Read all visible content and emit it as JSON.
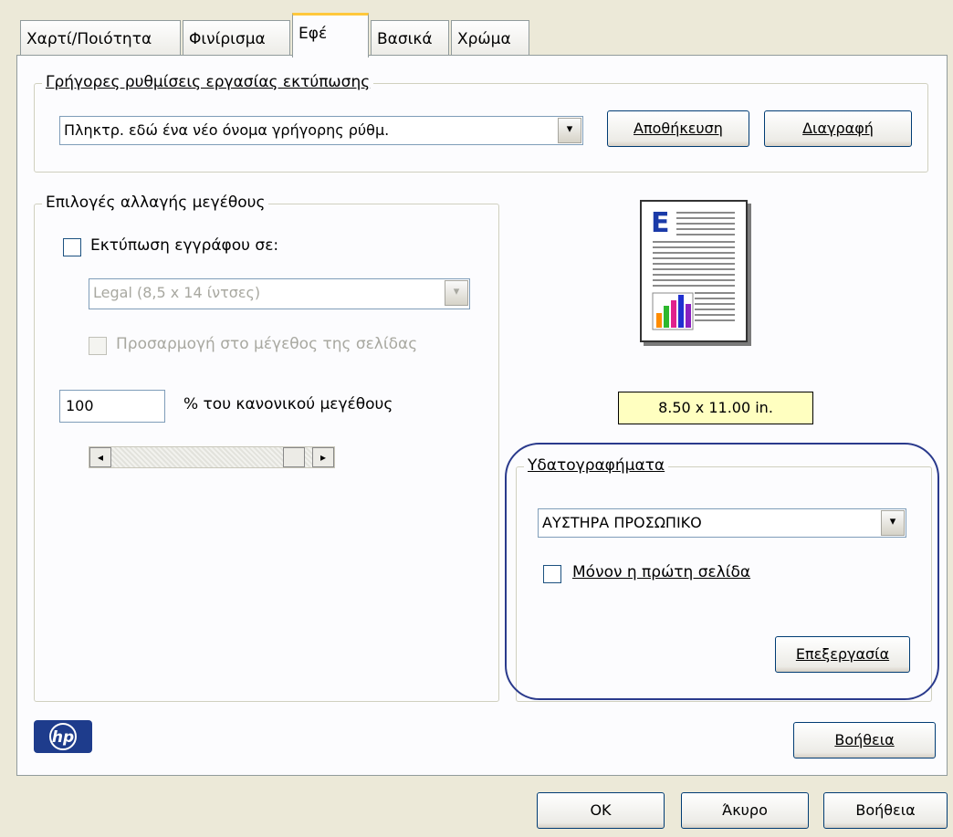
{
  "tabs": [
    "Χαρτί/Ποιότητα",
    "Φινίρισμα",
    "Εφέ",
    "Βασικά",
    "Χρώμα"
  ],
  "active_tab": "Εφέ",
  "quick_settings": {
    "legend": "Γρήγορες ρυθμίσεις εργασίας εκτύπωσης",
    "combo_value": "Πληκτρ. εδώ ένα νέο όνομα γρήγορης ρύθμ.",
    "save_label": "Αποθήκευση",
    "delete_label": "Διαγραφή"
  },
  "resize": {
    "legend": "Επιλογές αλλαγής μεγέθους",
    "print_doc_on_label": "Εκτύπωση εγγράφου σε:",
    "print_doc_on_checked": false,
    "paper_combo_value": "Legal (8,5 x 14 ίντσες)",
    "fit_page_label": "Προσαρμογή στο μέγεθος της σελίδας",
    "fit_page_checked": false,
    "percent_value": "100",
    "percent_label": "% του κανονικού μεγέθους"
  },
  "preview": {
    "size_text": "8.50 x 11.00 in.",
    "letter": "E"
  },
  "watermarks": {
    "legend": "Υδατογραφήματα",
    "combo_value": "ΑΥΣΤΗΡΑ ΠΡΟΣΩΠΙΚΟ",
    "first_page_only_label": "Μόνον η πρώτη σελίδα",
    "first_page_only_checked": false,
    "edit_label": "Επεξεργασία"
  },
  "help_label": "Βοήθεια",
  "footer": {
    "ok_label": "OK",
    "cancel_label": "Άκυρο",
    "help_label": "Βοήθεια"
  },
  "icons": {
    "combo_arrow": "▾",
    "scroll_left": "◂",
    "scroll_right": "▸",
    "logo": "hp-logo"
  },
  "colors": {
    "highlight_ring": "#2a3a8c",
    "size_box_bg": "#ffffc0",
    "tab_accent": "#ffc83c"
  }
}
